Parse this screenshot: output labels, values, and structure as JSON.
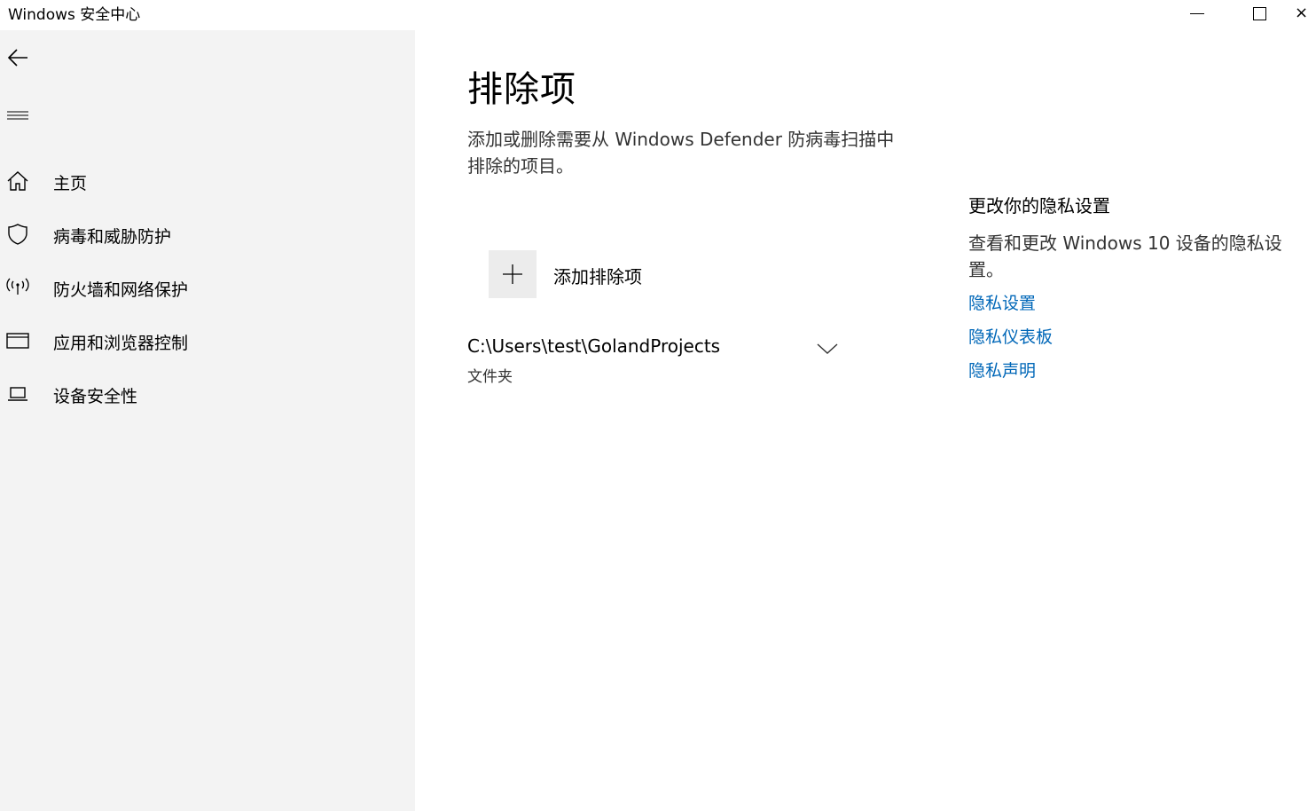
{
  "window": {
    "title": "Windows 安全中心",
    "close_glyph": "×"
  },
  "sidebar": {
    "back_icon": "back-arrow-icon",
    "menu_icon": "hamburger-menu-icon",
    "items": [
      {
        "label": "主页",
        "icon": "home-icon"
      },
      {
        "label": "病毒和威胁防护",
        "icon": "shield-icon"
      },
      {
        "label": "防火墙和网络保护",
        "icon": "wifi-antenna-icon"
      },
      {
        "label": "应用和浏览器控制",
        "icon": "app-window-icon"
      },
      {
        "label": "设备安全性",
        "icon": "laptop-icon"
      }
    ]
  },
  "main": {
    "title": "排除项",
    "description": "添加或删除需要从 Windows Defender 防病毒扫描中排除的项目。",
    "add_button": {
      "label": "添加排除项",
      "icon": "plus-icon"
    },
    "exclusions": [
      {
        "path": "C:\\Users\\test\\GolandProjects",
        "type": "文件夹"
      }
    ]
  },
  "privacy_panel": {
    "title": "更改你的隐私设置",
    "description": "查看和更改 Windows 10 设备的隐私设置。",
    "links": [
      "隐私设置",
      "隐私仪表板",
      "隐私声明"
    ]
  },
  "colors": {
    "sidebar_bg": "#f3f3f3",
    "link": "#0067b8",
    "add_icon_bg": "#ececec"
  }
}
